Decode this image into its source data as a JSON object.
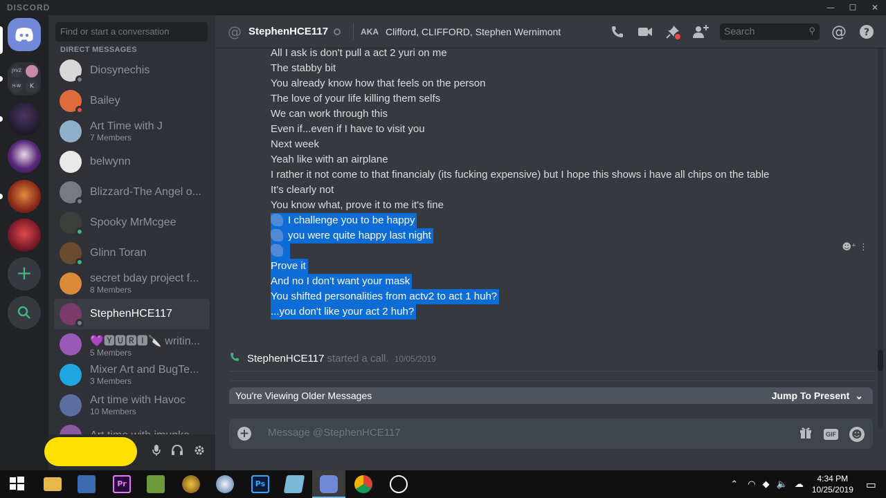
{
  "window": {
    "brand": "DISCORD"
  },
  "guild_bar": {
    "home_icon": "discord-logo-icon",
    "add_server": "+",
    "explore": "search-icon",
    "folder_labels": [
      "JYVZ",
      "H-W",
      "K"
    ]
  },
  "sidebar": {
    "search_placeholder": "Find or start a conversation",
    "section_header": "DIRECT MESSAGES",
    "dms": [
      {
        "name": "Diosynechis",
        "sub": "",
        "status": "offline",
        "color": "#d8d8d8"
      },
      {
        "name": "Bailey",
        "sub": "",
        "status": "dnd",
        "color": "#e06b3c"
      },
      {
        "name": "Art Time with J",
        "sub": "7 Members",
        "status": "",
        "color": "#8fb0c8"
      },
      {
        "name": "belwynn",
        "sub": "",
        "status": "",
        "color": "#e8e8e8"
      },
      {
        "name": "Blizzard-The Angel o...",
        "sub": "",
        "status": "offline",
        "color": "#777b80"
      },
      {
        "name": "Spooky MrMcgee",
        "sub": "",
        "status": "online",
        "color": "#3b3f3a"
      },
      {
        "name": "Glinn Toran",
        "sub": "",
        "status": "online",
        "color": "#6a4a30"
      },
      {
        "name": "secret bday project f...",
        "sub": "8 Members",
        "status": "",
        "color": "#d98b3a"
      },
      {
        "name": "StephenHCE117",
        "sub": "",
        "status": "offline",
        "color": "#7a3a6a"
      },
      {
        "name": "💜🆈🆄🆁🅸🔪 writin...",
        "sub": "5 Members",
        "status": "",
        "color": "#9b59b6"
      },
      {
        "name": "Mixer Art and BugTe...",
        "sub": "3 Members",
        "status": "",
        "color": "#1fa6e0"
      },
      {
        "name": "Art time with Havoc",
        "sub": "10 Members",
        "status": "",
        "color": "#5a6fa0"
      },
      {
        "name": "Art time with imunka",
        "sub": "",
        "status": "",
        "color": "#8a5aa0"
      }
    ]
  },
  "user_panel": {
    "mic": "mic-icon",
    "headphones": "headphones-icon",
    "settings": "gear-icon"
  },
  "chat_header": {
    "channel_name": "StephenHCE117",
    "aka_label": "AKA",
    "aka_names": "Clifford, CLIFFORD, Stephen Wernimont",
    "search_placeholder": "Search"
  },
  "messages": [
    {
      "text": "All I ask is don't pull a act 2 yuri on me",
      "selected": false
    },
    {
      "text": "The stabby bit",
      "selected": false
    },
    {
      "text": "You already know how that feels on the person",
      "selected": false
    },
    {
      "text": "The love of your life killing them selfs",
      "selected": false
    },
    {
      "text": "We can work through this",
      "selected": false
    },
    {
      "text": "Even if...even if I have to visit you",
      "selected": false
    },
    {
      "text": "Next week",
      "selected": false
    },
    {
      "text": "Yeah like with an airplane",
      "selected": false
    },
    {
      "text": "I rather it not come to that financialy (its fucking expensive) but I hope this shows i have all chips on the table",
      "selected": false
    },
    {
      "text": "It's clearly not",
      "selected": false
    },
    {
      "text": "You know what, prove it to me it's fine",
      "selected": false
    },
    {
      "text": "I challenge you to be happy",
      "selected": true,
      "emoji": true
    },
    {
      "text": "you were quite happy last night",
      "selected": true,
      "emoji": true
    },
    {
      "text": "",
      "selected": true,
      "emoji": true
    },
    {
      "text": "Prove it",
      "selected": true
    },
    {
      "text": "And no I don't want your mask",
      "selected": true
    },
    {
      "text": "You shifted personalities from actv2 to act 1 huh?",
      "selected": true
    },
    {
      "text": "...you don't like your act 2 huh?",
      "selected": true
    }
  ],
  "call_event": {
    "who": "StephenHCE117",
    "action": "started a call.",
    "timestamp": "10/05/2019"
  },
  "older_bar": {
    "label": "You're Viewing Older Messages",
    "jump": "Jump To Present"
  },
  "composer": {
    "placeholder": "Message @StephenHCE117"
  },
  "taskbar": {
    "time": "4:34 PM",
    "date": "10/25/2019"
  }
}
